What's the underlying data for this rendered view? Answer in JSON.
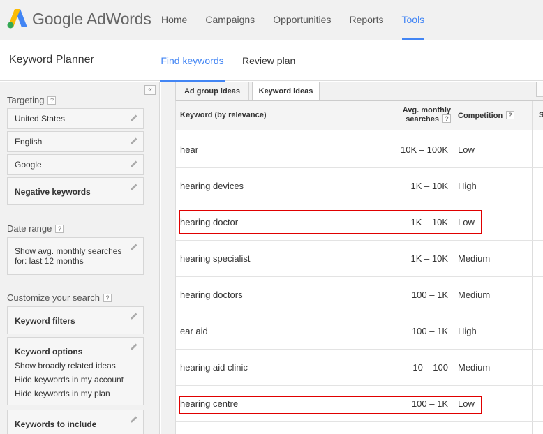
{
  "app": {
    "logo_text": "Google AdWords",
    "colors": {
      "accent": "#4285f4",
      "highlight": "#e00000"
    }
  },
  "nav": {
    "items": [
      {
        "label": "Home",
        "active": false
      },
      {
        "label": "Campaigns",
        "active": false
      },
      {
        "label": "Opportunities",
        "active": false
      },
      {
        "label": "Reports",
        "active": false
      },
      {
        "label": "Tools",
        "active": true
      }
    ]
  },
  "planner": {
    "title": "Keyword Planner",
    "tabs": {
      "find": "Find keywords",
      "review": "Review plan"
    }
  },
  "sidebar": {
    "collapse_label": "«",
    "targeting": {
      "title": "Targeting",
      "help": "?",
      "location": "United States",
      "language": "English",
      "network": "Google",
      "negative": "Negative keywords"
    },
    "date_range": {
      "title": "Date range",
      "help": "?",
      "line1": "Show avg. monthly searches",
      "line2": "for: last 12 months"
    },
    "customize": {
      "title": "Customize your search",
      "help": "?",
      "filters": "Keyword filters",
      "options_title": "Keyword options",
      "options": [
        "Show broadly related ideas",
        "Hide keywords in my account",
        "Hide keywords in my plan"
      ],
      "include": "Keywords to include"
    }
  },
  "subtabs": {
    "adgroup": "Ad group ideas",
    "keyword": "Keyword ideas"
  },
  "table": {
    "headers": {
      "keyword": "Keyword (by relevance)",
      "avg_line1": "Avg. monthly",
      "avg_line2": "searches",
      "help": "?",
      "competition": "Competition",
      "next": "S"
    },
    "rows": [
      {
        "keyword": "hear",
        "avg": "10K – 100K",
        "competition": "Low",
        "highlighted": false
      },
      {
        "keyword": "hearing devices",
        "avg": "1K – 10K",
        "competition": "High",
        "highlighted": false
      },
      {
        "keyword": "hearing doctor",
        "avg": "1K – 10K",
        "competition": "Low",
        "highlighted": true
      },
      {
        "keyword": "hearing specialist",
        "avg": "1K – 10K",
        "competition": "Medium",
        "highlighted": false
      },
      {
        "keyword": "hearing doctors",
        "avg": "100 – 1K",
        "competition": "Medium",
        "highlighted": false
      },
      {
        "keyword": "ear aid",
        "avg": "100 – 1K",
        "competition": "High",
        "highlighted": false
      },
      {
        "keyword": "hearing aid clinic",
        "avg": "10 – 100",
        "competition": "Medium",
        "highlighted": false
      },
      {
        "keyword": "hearing centre",
        "avg": "100 – 1K",
        "competition": "Low",
        "highlighted": true
      }
    ]
  }
}
